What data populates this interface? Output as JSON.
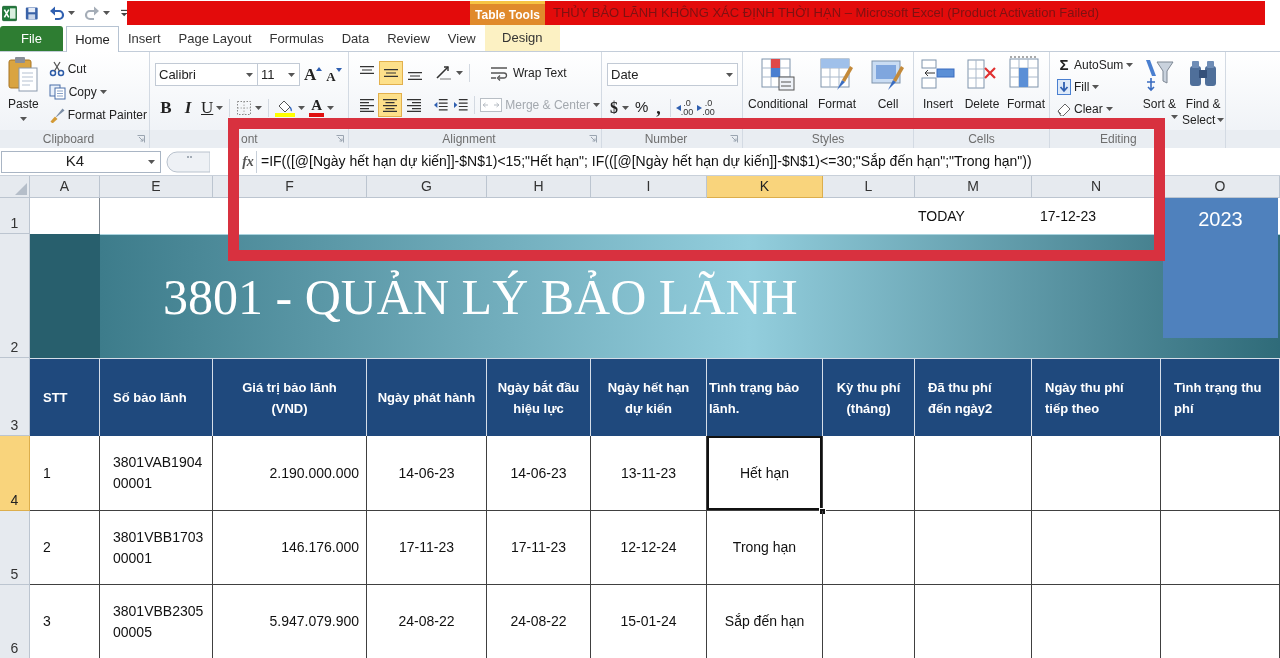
{
  "title_bar": {
    "redo_disabled": true,
    "contextual_group": "Table Tools",
    "title": "THỦY BẢO LÃNH KHÔNG XÁC ĐỊNH THỜI HẠN – Microsoft Excel (Product Activation Failed)"
  },
  "tabs": [
    {
      "label": "File",
      "kind": "file",
      "selected": false
    },
    {
      "label": "Home",
      "kind": "standard",
      "selected": true
    },
    {
      "label": "Insert",
      "kind": "standard",
      "selected": false
    },
    {
      "label": "Page Layout",
      "kind": "standard",
      "selected": false
    },
    {
      "label": "Formulas",
      "kind": "standard",
      "selected": false
    },
    {
      "label": "Data",
      "kind": "standard",
      "selected": false
    },
    {
      "label": "Review",
      "kind": "standard",
      "selected": false
    },
    {
      "label": "View",
      "kind": "standard",
      "selected": false
    },
    {
      "label": "Design",
      "kind": "contextual",
      "selected": false
    }
  ],
  "ribbon": {
    "clipboard": {
      "paste": "Paste",
      "cut": "Cut",
      "copy": "Copy",
      "format_painter": "Format Painter",
      "label": "Clipboard"
    },
    "font": {
      "font_name": "Calibri",
      "font_size": "11",
      "grow_font": "A",
      "shrink_font": "A",
      "bold": "B",
      "italic": "I",
      "underline": "U",
      "font_color": "A",
      "label": "ont"
    },
    "alignment": {
      "vertical": [
        {
          "kind": "top",
          "selected": false
        },
        {
          "kind": "middle",
          "selected": true
        },
        {
          "kind": "bottom",
          "selected": false
        }
      ],
      "wrap_text": "Wrap Text",
      "horizontal": [
        {
          "kind": "left",
          "selected": false
        },
        {
          "kind": "center",
          "selected": true
        },
        {
          "kind": "right",
          "selected": false
        }
      ],
      "merge_center": {
        "label": "Merge & Center",
        "disabled": true
      },
      "label": "Alignment"
    },
    "number": {
      "format": "Date",
      "currency": "$",
      "percent": "%",
      "comma": ",",
      "increase_decimal": [
        ".0",
        ".00"
      ],
      "decrease_decimal": [
        ".0",
        ".00"
      ],
      "label": "Number"
    },
    "styles": {
      "conditional_formatting": "Conditional",
      "format_as_table": "Format",
      "cell_styles": "Cell",
      "label": "Styles"
    },
    "cells": {
      "insert": "Insert",
      "delete": "Delete",
      "format": "Format",
      "label": "Cells"
    },
    "editing": {
      "autosum_symbol": "Σ",
      "autosum": "AutoSum",
      "fill": "Fill",
      "clear": "Clear",
      "sort_filter": "Sort &",
      "find_select": [
        "Find &",
        "Select"
      ],
      "label": "Editing"
    }
  },
  "formula_bar": {
    "name_box": "K4",
    "function_label": "fx",
    "formula": "=IF(([@[Ngày hết hạn dự kiến]]-$N$1)<15;\"Hết hạn\"; IF(([@[Ngày hết hạn dự kiến]]-$N$1)<=30;\"Sắp đến hạn\";\"Trong hạn\"))"
  },
  "sheet": {
    "column_headers": [
      {
        "label": "A",
        "selected": false
      },
      {
        "label": "E",
        "selected": false
      },
      {
        "label": "F",
        "selected": false
      },
      {
        "label": "G",
        "selected": false
      },
      {
        "label": "H",
        "selected": false
      },
      {
        "label": "I",
        "selected": false
      },
      {
        "label": "K",
        "selected": true
      },
      {
        "label": "L",
        "selected": false
      },
      {
        "label": "M",
        "selected": false
      },
      {
        "label": "N",
        "selected": false
      },
      {
        "label": "O",
        "selected": false
      }
    ],
    "row_headers": [
      {
        "label": "1",
        "selected": false
      },
      {
        "label": "2",
        "selected": false
      },
      {
        "label": "3",
        "selected": false
      },
      {
        "label": "4",
        "selected": true
      },
      {
        "label": "5",
        "selected": false
      },
      {
        "label": "6",
        "selected": false
      }
    ],
    "today_label": "TODAY",
    "today_value": "17-12-23",
    "year_box": "2023",
    "banner_title": "3801 - QUẢN LÝ BẢO LÃNH",
    "table": {
      "columns": [
        "STT",
        "Số bảo lãnh",
        "Giá trị bảo lãnh (VND)",
        "Ngày phát hành",
        "Ngày bắt đầu hiệu lực",
        "Ngày hết hạn dự kiến",
        "Tình trạng bảo lãnh.",
        "Kỳ thu phí (tháng)",
        "Đã thu phí đến ngày2",
        "Ngày thu phí tiếp theo",
        "Tình trạng thu phí"
      ],
      "rows": [
        {
          "cells": [
            {
              "text": "1",
              "selected": false
            },
            {
              "text": "3801VAB190400001",
              "selected": false
            },
            {
              "text": "2.190.000.000",
              "selected": false
            },
            {
              "text": "14-06-23",
              "selected": false
            },
            {
              "text": "14-06-23",
              "selected": false
            },
            {
              "text": "13-11-23",
              "selected": false
            },
            {
              "text": "Hết hạn",
              "selected": true
            }
          ]
        },
        {
          "cells": [
            {
              "text": "2",
              "selected": false
            },
            {
              "text": "3801VBB170300001",
              "selected": false
            },
            {
              "text": "146.176.000",
              "selected": false
            },
            {
              "text": "17-11-23",
              "selected": false
            },
            {
              "text": "17-11-23",
              "selected": false
            },
            {
              "text": "12-12-24",
              "selected": false
            },
            {
              "text": "Trong hạn",
              "selected": false
            }
          ]
        },
        {
          "cells": [
            {
              "text": "3",
              "selected": false
            },
            {
              "text": "3801VBB230500005",
              "selected": false
            },
            {
              "text": "5.947.079.900",
              "selected": false
            },
            {
              "text": "24-08-22",
              "selected": false
            },
            {
              "text": "24-08-22",
              "selected": false
            },
            {
              "text": "15-01-24",
              "selected": false
            },
            {
              "text": "Sắp đến hạn",
              "selected": false
            }
          ]
        }
      ]
    }
  }
}
